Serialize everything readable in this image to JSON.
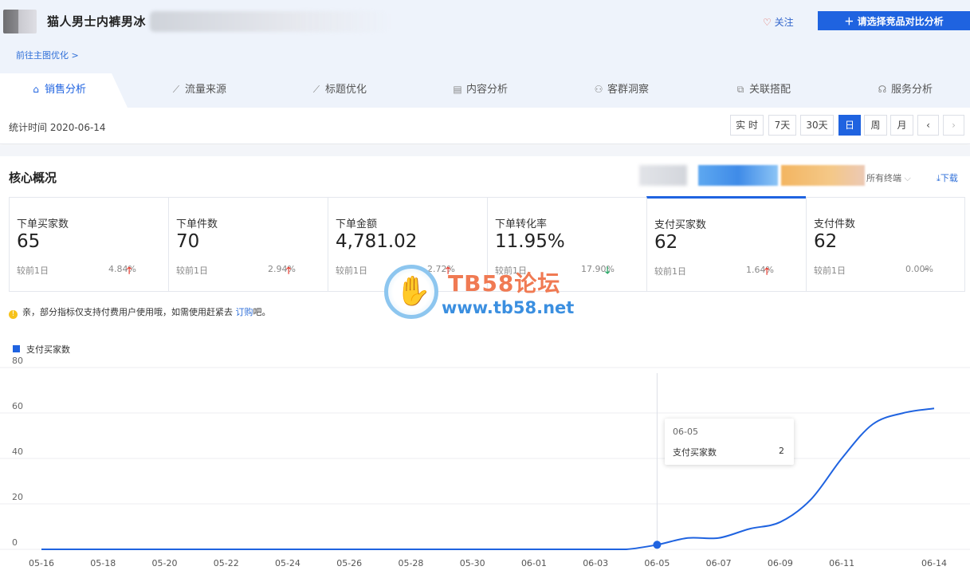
{
  "product": {
    "title": "猫人男士内裤男冰",
    "follow_label": "关注",
    "compare_button": "请选择竞品对比分析",
    "optimize_link": "前往主图优化 >"
  },
  "tabs": [
    {
      "label": "销售分析",
      "icon": "shopping-bag-icon",
      "active": true
    },
    {
      "label": "流量来源",
      "icon": "line-chart-icon"
    },
    {
      "label": "标题优化",
      "icon": "trend-chart-icon"
    },
    {
      "label": "内容分析",
      "icon": "document-icon"
    },
    {
      "label": "客群洞察",
      "icon": "users-icon"
    },
    {
      "label": "关联搭配",
      "icon": "link-icon"
    },
    {
      "label": "服务分析",
      "icon": "headset-icon"
    }
  ],
  "timebar": {
    "stat_time": "统计时间 2020-06-14",
    "buttons": [
      "实 时",
      "7天",
      "30天",
      "日",
      "周",
      "月"
    ],
    "active": "日"
  },
  "core": {
    "title": "核心概况",
    "device": "所有终端",
    "download": "下载",
    "cards": [
      {
        "label": "下单买家数",
        "value": "65",
        "compare": "较前1日",
        "pct": "4.84%",
        "dir": "up"
      },
      {
        "label": "下单件数",
        "value": "70",
        "compare": "较前1日",
        "pct": "2.94%",
        "dir": "up"
      },
      {
        "label": "下单金额",
        "value": "4,781.02",
        "compare": "较前1日",
        "pct": "2.72%",
        "dir": "up"
      },
      {
        "label": "下单转化率",
        "value": "11.95%",
        "compare": "较前1日",
        "pct": "17.90%",
        "dir": "down"
      },
      {
        "label": "支付买家数",
        "value": "62",
        "compare": "较前1日",
        "pct": "1.64%",
        "dir": "up",
        "active": true
      },
      {
        "label": "支付件数",
        "value": "62",
        "compare": "较前1日",
        "pct": "0.00%",
        "dir": "flat"
      }
    ]
  },
  "notice": {
    "text_before": "亲，部分指标仅支持付费用户使用哦，如需使用赶紧去 ",
    "link": "订购",
    "text_after": "吧。"
  },
  "watermark": {
    "title": "TB58论坛",
    "url": "www.tb58.net"
  },
  "colors": {
    "accent": "#1f63e0",
    "up": "#e63a2e",
    "down": "#1aa35c"
  },
  "chart_data": {
    "type": "line",
    "legend": "支付买家数",
    "ylim": [
      0,
      80
    ],
    "yticks": [
      0,
      20,
      40,
      60,
      80
    ],
    "x_tick_labels": [
      "05-16",
      "05-18",
      "05-20",
      "05-22",
      "05-24",
      "05-26",
      "05-28",
      "05-30",
      "06-01",
      "06-03",
      "06-05",
      "06-07",
      "06-09",
      "06-11",
      "06-14"
    ],
    "x": [
      "05-16",
      "05-17",
      "05-18",
      "05-19",
      "05-20",
      "05-21",
      "05-22",
      "05-23",
      "05-24",
      "05-25",
      "05-26",
      "05-27",
      "05-28",
      "05-29",
      "05-30",
      "05-31",
      "06-01",
      "06-02",
      "06-03",
      "06-04",
      "06-05",
      "06-06",
      "06-07",
      "06-08",
      "06-09",
      "06-10",
      "06-11",
      "06-12",
      "06-13",
      "06-14"
    ],
    "series": [
      {
        "name": "支付买家数",
        "values": [
          0,
          0,
          0,
          0,
          0,
          0,
          0,
          0,
          0,
          0,
          0,
          0,
          0,
          0,
          0,
          0,
          0,
          0,
          0,
          0,
          2,
          5,
          5,
          9,
          12,
          22,
          40,
          55,
          60,
          62
        ]
      }
    ],
    "tooltip": {
      "date": "06-05",
      "name": "支付买家数",
      "value": "2"
    },
    "grid": true
  }
}
